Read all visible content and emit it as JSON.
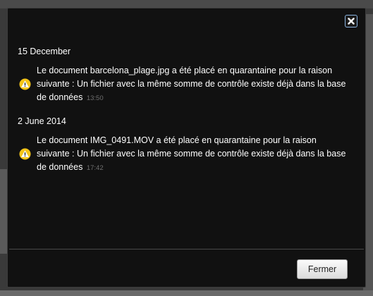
{
  "dialog": {
    "close_icon": "close-x-icon",
    "groups": [
      {
        "date": "15 December",
        "items": [
          {
            "icon": "warning-icon",
            "message": "Le document barcelona_plage.jpg a été placé en quarantaine pour la raison suivante : Un fichier avec la même somme de contrôle existe déjà dans la base de données",
            "time": "13:50"
          }
        ]
      },
      {
        "date": "2 June 2014",
        "items": [
          {
            "icon": "warning-icon",
            "message": "Le document IMG_0491.MOV a été placé en quarantaine pour la raison suivante : Un fichier avec la même somme de contrôle existe déjà dans la base de données",
            "time": "17:42"
          }
        ]
      }
    ],
    "close_button_label": "Fermer"
  },
  "colors": {
    "dialog_bg": "#111111",
    "text": "#ffffff",
    "timestamp": "#6f6f6f",
    "warning": "#f5c518",
    "close_border": "#8ab4e0"
  }
}
